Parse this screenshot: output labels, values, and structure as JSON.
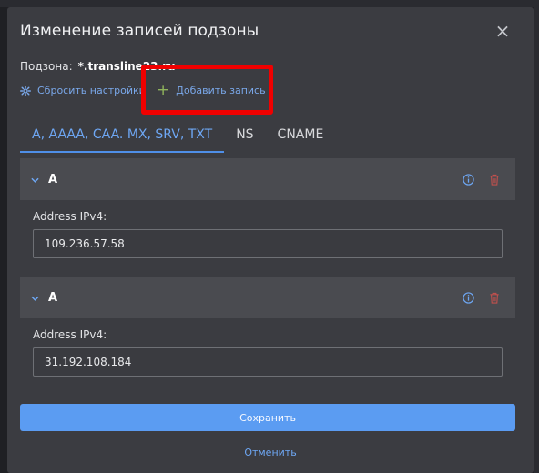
{
  "modal": {
    "title": "Изменение записей подзоны",
    "close_label": "×"
  },
  "subzone": {
    "label": "Подзона:",
    "value": "*.transline23.ru"
  },
  "actions": {
    "reset_label": "Сбросить настройки",
    "add_label": "Добавить запись",
    "add_symbol": "+"
  },
  "tabs": [
    {
      "label": "A, AAAA, CAA. MX, SRV, TXT",
      "active": true
    },
    {
      "label": "NS",
      "active": false
    },
    {
      "label": "CNAME",
      "active": false
    }
  ],
  "records": [
    {
      "type": "A",
      "field_label": "Address IPv4:",
      "value": "109.236.57.58"
    },
    {
      "type": "A",
      "field_label": "Address IPv4:",
      "value": "31.192.108.184"
    }
  ],
  "footer": {
    "save_label": "Сохранить",
    "cancel_label": "Отменить"
  },
  "colors": {
    "accent": "#5b9cf2",
    "highlight": "#f00000",
    "delete": "#c0504d",
    "add_plus": "#8fb35c"
  },
  "icons": {
    "reset": "gear-icon",
    "add": "plus-icon",
    "info": "info-icon",
    "delete": "trash-icon",
    "collapse": "chevron-down-icon",
    "close": "close-icon"
  }
}
